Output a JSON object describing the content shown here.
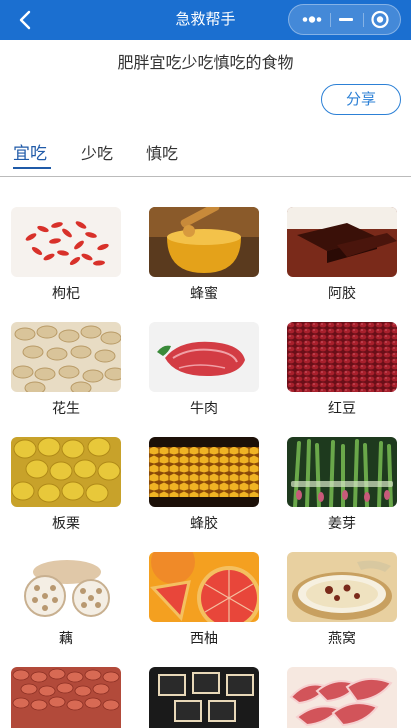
{
  "header": {
    "title": "急救帮手",
    "back_icon": "chevron-left-icon",
    "capsule_icons": [
      "more-dots-icon",
      "minimize-icon",
      "target-close-icon"
    ]
  },
  "page": {
    "subtitle": "肥胖宜吃少吃慎吃的食物",
    "share_label": "分享"
  },
  "tabs": [
    {
      "label": "宜吃",
      "active": true
    },
    {
      "label": "少吃",
      "active": false
    },
    {
      "label": "慎吃",
      "active": false
    }
  ],
  "foods": [
    {
      "name": "枸杞"
    },
    {
      "name": "蜂蜜"
    },
    {
      "name": "阿胶"
    },
    {
      "name": "花生"
    },
    {
      "name": "牛肉"
    },
    {
      "name": "红豆"
    },
    {
      "name": "板栗"
    },
    {
      "name": "蜂胶"
    },
    {
      "name": "姜芽"
    },
    {
      "name": "藕"
    },
    {
      "name": "西柚"
    },
    {
      "name": "燕窝"
    },
    {
      "name": ""
    },
    {
      "name": ""
    },
    {
      "name": ""
    }
  ],
  "colors": {
    "brand": "#1b6fd0",
    "tab_active": "#1f5aa8",
    "share_border": "#2c80d6"
  }
}
